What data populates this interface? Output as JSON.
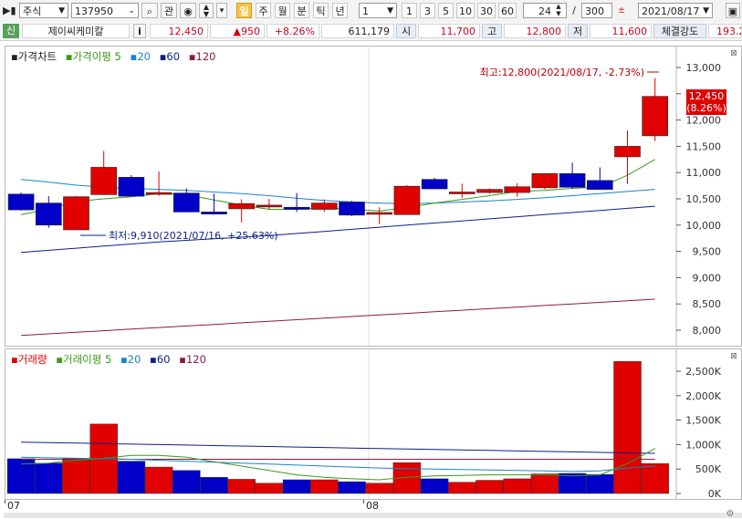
{
  "toolbar": {
    "market_type": "주식",
    "code": "137950",
    "search_icon": "magnifier-icon",
    "related_label": "관",
    "period_tabs": [
      "일",
      "주",
      "월",
      "분",
      "틱",
      "년"
    ],
    "selected_period": "일",
    "interval_value": "1",
    "interval_presets": [
      "1",
      "3",
      "5",
      "10",
      "30",
      "60"
    ],
    "bar_count": "24",
    "bar_separator": "/",
    "bar_total": "300",
    "date": "2021/08/17"
  },
  "info": {
    "tag": "신",
    "stock_name": "제이씨케미칼",
    "info_button": "i",
    "price": "12,450",
    "change": "▲950",
    "change_pct": "+8.26%",
    "volume": "611,179",
    "open_label": "시",
    "open": "11,700",
    "high_label": "고",
    "high": "12,800",
    "low_label": "저",
    "low": "11,600",
    "strength_label": "체결강도",
    "strength": "193.2"
  },
  "colors": {
    "up": "#e00000",
    "down": "#0000c8",
    "ma5": "#3a9a1a",
    "ma20": "#1a84c8",
    "ma60": "#0c1f8c",
    "ma120": "#8a1a4a"
  },
  "price_panel": {
    "legend": [
      {
        "label": "가격차트",
        "color": "#000000"
      },
      {
        "label": "가격이평 5",
        "color": "#3a9a1a"
      },
      {
        "label": "20",
        "color": "#1a84c8"
      },
      {
        "label": "60",
        "color": "#0c1f8c"
      },
      {
        "label": "120",
        "color": "#8a1a4a"
      }
    ],
    "high_annotation": "최고:12,800(2021/08/17, -2.73%)",
    "low_annotation": "최저:9,910(2021/07/16, +25.63%)",
    "last_price_label": "12,450",
    "last_pct_label": "(8.26%)"
  },
  "volume_panel": {
    "legend": [
      {
        "label": "거래량",
        "color": "#e00000"
      },
      {
        "label": "거래이평 5",
        "color": "#3a9a1a"
      },
      {
        "label": "20",
        "color": "#1a84c8"
      },
      {
        "label": "60",
        "color": "#0c1f8c"
      },
      {
        "label": "120",
        "color": "#8a1a4a"
      }
    ]
  },
  "x_labels": [
    "07",
    "08"
  ],
  "chart_data": {
    "type": "candlestick",
    "price_axis": {
      "ticks": [
        8000,
        8500,
        9000,
        9500,
        10000,
        10500,
        11000,
        11500,
        12000,
        12500,
        13000
      ],
      "tick_labels": [
        "8,000",
        "8,500",
        "9,000",
        "9,500",
        "10,000",
        "10,500",
        "11,000",
        "11,500",
        "12,000",
        "12,500",
        "13,000"
      ]
    },
    "candles": [
      {
        "o": 10590,
        "h": 10620,
        "l": 10280,
        "c": 10290
      },
      {
        "o": 10420,
        "h": 10550,
        "l": 9950,
        "c": 10000
      },
      {
        "o": 9910,
        "h": 10550,
        "l": 9910,
        "c": 10540
      },
      {
        "o": 10580,
        "h": 11410,
        "l": 10580,
        "c": 11100
      },
      {
        "o": 10910,
        "h": 10950,
        "l": 10550,
        "c": 10550
      },
      {
        "o": 10600,
        "h": 11020,
        "l": 10560,
        "c": 10620
      },
      {
        "o": 10610,
        "h": 10700,
        "l": 10250,
        "c": 10250
      },
      {
        "o": 10250,
        "h": 10600,
        "l": 10200,
        "c": 10210
      },
      {
        "o": 10310,
        "h": 10490,
        "l": 10050,
        "c": 10410
      },
      {
        "o": 10350,
        "h": 10500,
        "l": 10300,
        "c": 10380
      },
      {
        "o": 10340,
        "h": 10610,
        "l": 10250,
        "c": 10300
      },
      {
        "o": 10300,
        "h": 10490,
        "l": 10250,
        "c": 10420
      },
      {
        "o": 10440,
        "h": 10460,
        "l": 10170,
        "c": 10190
      },
      {
        "o": 10210,
        "h": 10340,
        "l": 10020,
        "c": 10240
      },
      {
        "o": 10200,
        "h": 10760,
        "l": 10200,
        "c": 10740
      },
      {
        "o": 10870,
        "h": 10900,
        "l": 10680,
        "c": 10690
      },
      {
        "o": 10630,
        "h": 10790,
        "l": 10520,
        "c": 10630
      },
      {
        "o": 10620,
        "h": 10700,
        "l": 10600,
        "c": 10680
      },
      {
        "o": 10620,
        "h": 10800,
        "l": 10540,
        "c": 10730
      },
      {
        "o": 10710,
        "h": 10990,
        "l": 10680,
        "c": 10980
      },
      {
        "o": 10980,
        "h": 11190,
        "l": 10690,
        "c": 10720
      },
      {
        "o": 10850,
        "h": 11100,
        "l": 10670,
        "c": 10680
      },
      {
        "o": 11300,
        "h": 11800,
        "l": 10780,
        "c": 11500
      },
      {
        "o": 11700,
        "h": 12800,
        "l": 11600,
        "c": 12450
      }
    ],
    "ma5": [
      10200,
      10300,
      10450,
      10500,
      10540,
      10600,
      10580,
      10480,
      10380,
      10300,
      10300,
      10330,
      10300,
      10270,
      10330,
      10420,
      10490,
      10560,
      10640,
      10660,
      10700,
      10720,
      10950,
      11250
    ],
    "ma20": [
      10870,
      10820,
      10760,
      10720,
      10700,
      10680,
      10660,
      10630,
      10600,
      10560,
      10510,
      10470,
      10440,
      10420,
      10410,
      10420,
      10440,
      10460,
      10490,
      10520,
      10560,
      10600,
      10640,
      10680
    ],
    "ma60": [
      9480,
      9520,
      9560,
      9600,
      9640,
      9680,
      9710,
      9740,
      9770,
      9800,
      9840,
      9880,
      9920,
      9960,
      10000,
      10040,
      10080,
      10120,
      10160,
      10200,
      10240,
      10280,
      10320,
      10360
    ],
    "ma120": [
      7900,
      7930,
      7960,
      7990,
      8020,
      8050,
      8080,
      8110,
      8140,
      8170,
      8200,
      8230,
      8260,
      8290,
      8320,
      8350,
      8380,
      8410,
      8440,
      8470,
      8500,
      8530,
      8560,
      8590
    ],
    "volume_axis": {
      "ticks": [
        0,
        500000,
        1000000,
        1500000,
        2000000,
        2500000
      ],
      "tick_labels": [
        "0K",
        "500K",
        "1,000K",
        "1,500K",
        "2,000K",
        "2,500K"
      ]
    },
    "volumes": [
      710000,
      620000,
      720000,
      1420000,
      660000,
      540000,
      470000,
      330000,
      290000,
      210000,
      280000,
      280000,
      240000,
      210000,
      630000,
      300000,
      230000,
      270000,
      300000,
      400000,
      410000,
      390000,
      2700000,
      611179
    ],
    "vol_ma5": [
      600000,
      620000,
      680000,
      720000,
      780000,
      780000,
      740000,
      650000,
      560000,
      470000,
      380000,
      330000,
      300000,
      280000,
      330000,
      360000,
      370000,
      380000,
      380000,
      380000,
      360000,
      380000,
      610000,
      920000
    ],
    "vol_ma20": [
      740000,
      730000,
      720000,
      710000,
      700000,
      680000,
      660000,
      640000,
      620000,
      600000,
      580000,
      560000,
      540000,
      520000,
      510000,
      500000,
      490000,
      480000,
      470000,
      460000,
      450000,
      460000,
      520000,
      560000
    ],
    "vol_ma60": [
      1050000,
      1040000,
      1030000,
      1020000,
      1010000,
      1000000,
      990000,
      980000,
      970000,
      960000,
      950000,
      940000,
      930000,
      920000,
      910000,
      900000,
      890000,
      880000,
      870000,
      860000,
      850000,
      840000,
      830000,
      820000
    ],
    "vol_ma120": [
      700000,
      700000,
      700000,
      700000,
      700000,
      700000,
      700000,
      700000,
      700000,
      700000,
      700000,
      700000,
      700000,
      700000,
      700000,
      700000,
      700000,
      700000,
      700000,
      700000,
      700000,
      700000,
      700000,
      700000
    ],
    "month_start_index": {
      "07": 0,
      "08": 13
    }
  }
}
